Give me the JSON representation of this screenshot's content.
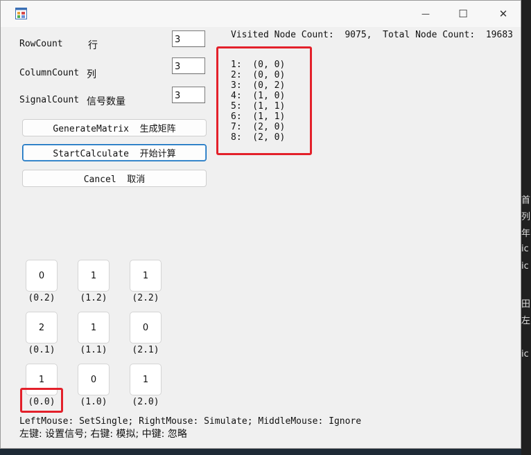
{
  "window": {
    "controls": {
      "minimize": "—",
      "maximize": "☐",
      "close": "✕"
    }
  },
  "form": {
    "row_label": "RowCount",
    "row_cn": "行",
    "row_value": "3",
    "col_label": "ColumnCount",
    "col_cn": "列",
    "col_value": "3",
    "sig_label": "SignalCount",
    "sig_cn": "信号数量",
    "sig_value": "3"
  },
  "buttons": {
    "generate": "GenerateMatrix  生成矩阵",
    "start": "StartCalculate  开始计算",
    "cancel": "Cancel  取消"
  },
  "status": "Visited Node Count:  9075,  Total Node Count:  19683",
  "results": [
    "1:  (0, 0)",
    "2:  (0, 0)",
    "3:  (0, 2)",
    "4:  (1, 0)",
    "5:  (1, 1)",
    "6:  (1, 1)",
    "7:  (2, 0)",
    "8:  (2, 0)"
  ],
  "grid": [
    [
      {
        "value": "0",
        "coord": "(0.2)"
      },
      {
        "value": "1",
        "coord": "(1.2)"
      },
      {
        "value": "1",
        "coord": "(2.2)"
      }
    ],
    [
      {
        "value": "2",
        "coord": "(0.1)"
      },
      {
        "value": "1",
        "coord": "(1.1)"
      },
      {
        "value": "0",
        "coord": "(2.1)"
      }
    ],
    [
      {
        "value": "1",
        "coord": "(0.0)"
      },
      {
        "value": "0",
        "coord": "(1.0)"
      },
      {
        "value": "1",
        "coord": "(2.0)"
      }
    ]
  ],
  "help": {
    "en": "LeftMouse: SetSingle; RightMouse: Simulate; MiddleMouse: Ignore",
    "cn": "左键: 设置信号; 右键: 模拟; 中键: 忽略"
  },
  "background_fragments": [
    "首",
    "列",
    "年",
    "ic",
    "ic",
    "田",
    "左",
    "ic"
  ]
}
